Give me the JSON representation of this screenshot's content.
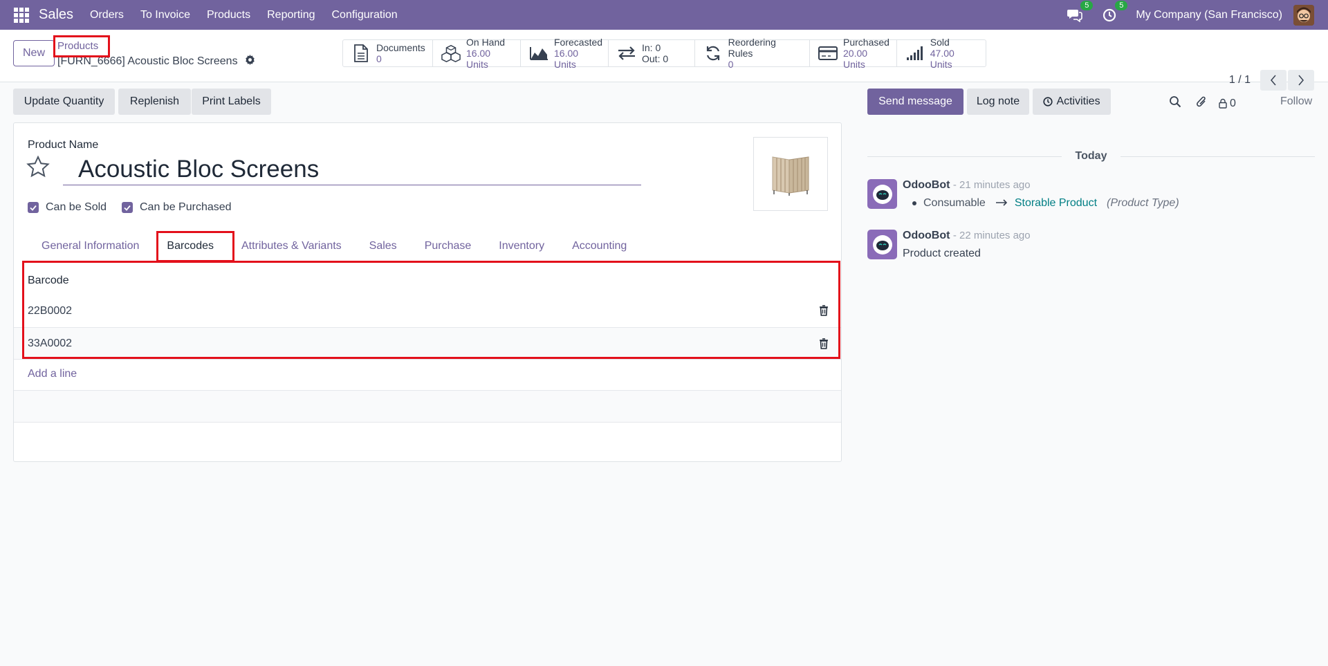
{
  "navbar": {
    "brand": "Sales",
    "menu": [
      "Orders",
      "To Invoice",
      "Products",
      "Reporting",
      "Configuration"
    ],
    "messages_count": "5",
    "activities_count": "5",
    "company": "My Company (San Francisco)"
  },
  "control_panel": {
    "new_label": "New",
    "breadcrumb_parent": "Products",
    "breadcrumb_current": "[FURN_6666] Acoustic Bloc Screens",
    "pager": "1 / 1"
  },
  "smart_buttons": [
    {
      "label": "Documents",
      "value": "0",
      "icon": "document-icon"
    },
    {
      "label": "On Hand",
      "value": "16.00 Units",
      "icon": "cubes-icon"
    },
    {
      "label": "Forecasted",
      "value": "16.00 Units",
      "icon": "area-chart-icon"
    },
    {
      "label": "In: 0",
      "value": "Out: 0",
      "icon": "exchange-icon"
    },
    {
      "label": "Reordering Rules",
      "value": "0",
      "icon": "refresh-icon"
    },
    {
      "label": "Purchased",
      "value": "20.00 Units",
      "icon": "credit-card-icon"
    },
    {
      "label": "Sold",
      "value": "47.00 Units",
      "icon": "signal-icon"
    }
  ],
  "actions": {
    "update_quantity": "Update Quantity",
    "replenish": "Replenish",
    "print_labels": "Print Labels"
  },
  "form": {
    "product_name_label": "Product Name",
    "product_name": "Acoustic Bloc Screens",
    "can_be_sold": "Can be Sold",
    "can_be_purchased": "Can be Purchased",
    "tabs": [
      "General Information",
      "Barcodes",
      "Attributes & Variants",
      "Sales",
      "Purchase",
      "Inventory",
      "Accounting"
    ],
    "active_tab": "Barcodes",
    "barcode_header": "Barcode",
    "barcodes": [
      "22B0002",
      "33A0002"
    ],
    "add_line": "Add a line"
  },
  "chatter": {
    "send_message": "Send message",
    "log_note": "Log note",
    "activities": "Activities",
    "followers_count": "0",
    "follow": "Follow",
    "today": "Today",
    "messages": [
      {
        "author": "OdooBot",
        "time": "- 21 minutes ago",
        "old_value": "Consumable",
        "new_value": "Storable Product",
        "field": "(Product Type)"
      },
      {
        "author": "OdooBot",
        "time": "- 22 minutes ago",
        "body": "Product created"
      }
    ]
  },
  "colors": {
    "brand": "#71639e",
    "highlight": "#e3101b",
    "badge": "#28a745",
    "link_teal": "#017e84"
  }
}
